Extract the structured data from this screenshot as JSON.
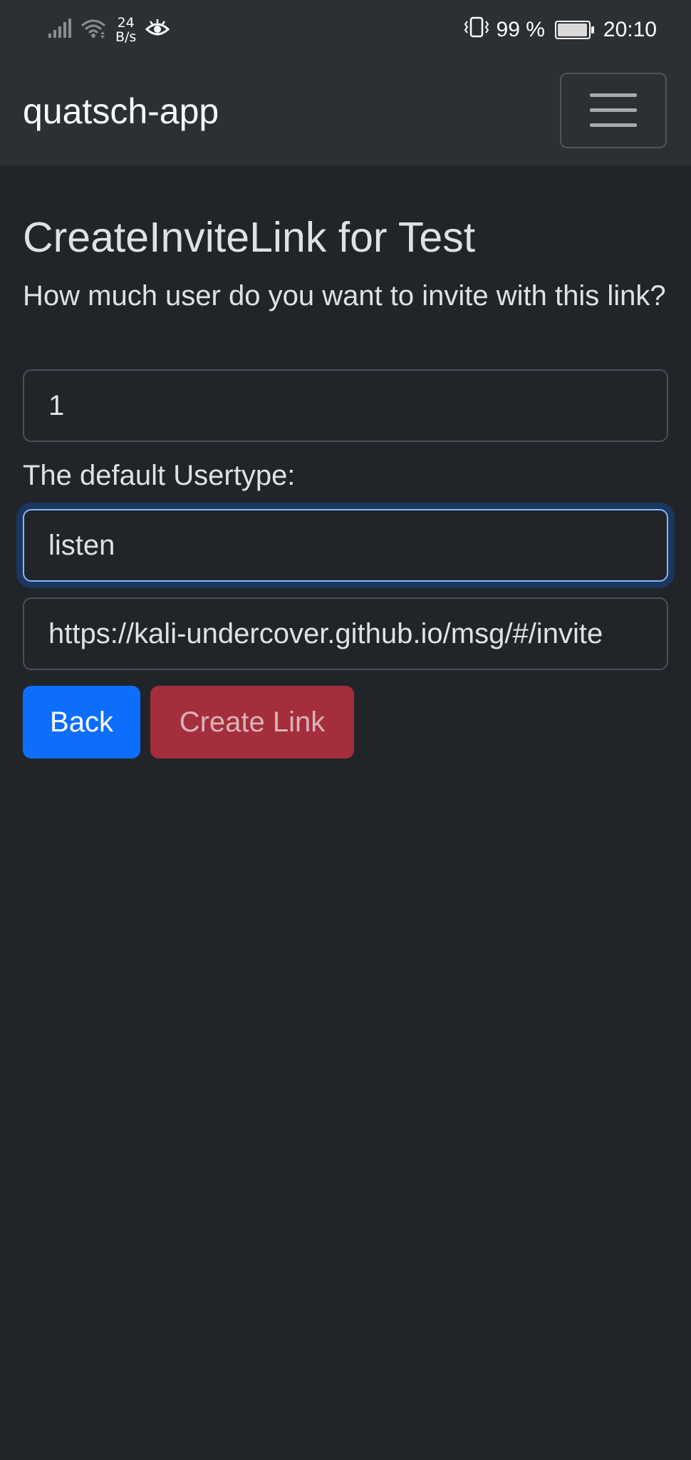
{
  "status_bar": {
    "net_speed_value": "24",
    "net_speed_unit": "B/s",
    "battery_percent": "99 %",
    "battery_level": 0.99,
    "time": "20:10",
    "icons": [
      "signal-icon",
      "wifi-icon",
      "eye-icon",
      "vibrate-icon",
      "battery-icon"
    ]
  },
  "navbar": {
    "brand": "quatsch-app",
    "menu_icon": "hamburger-icon"
  },
  "page": {
    "title": "CreateInviteLink for Test",
    "count_label": "How much user do you want to invite with this link?",
    "count_value": "1",
    "usertype_label": "The default Usertype:",
    "usertype_value": "listen",
    "link_value": "https://kali-undercover.github.io/msg/#/invite"
  },
  "buttons": {
    "back_label": "Back",
    "create_label": "Create Link"
  },
  "colors": {
    "background": "#212529",
    "navbar": "#2b3035",
    "primary": "#0d6efd",
    "danger": "#a52e3c",
    "focus_border": "#86b7fe"
  }
}
